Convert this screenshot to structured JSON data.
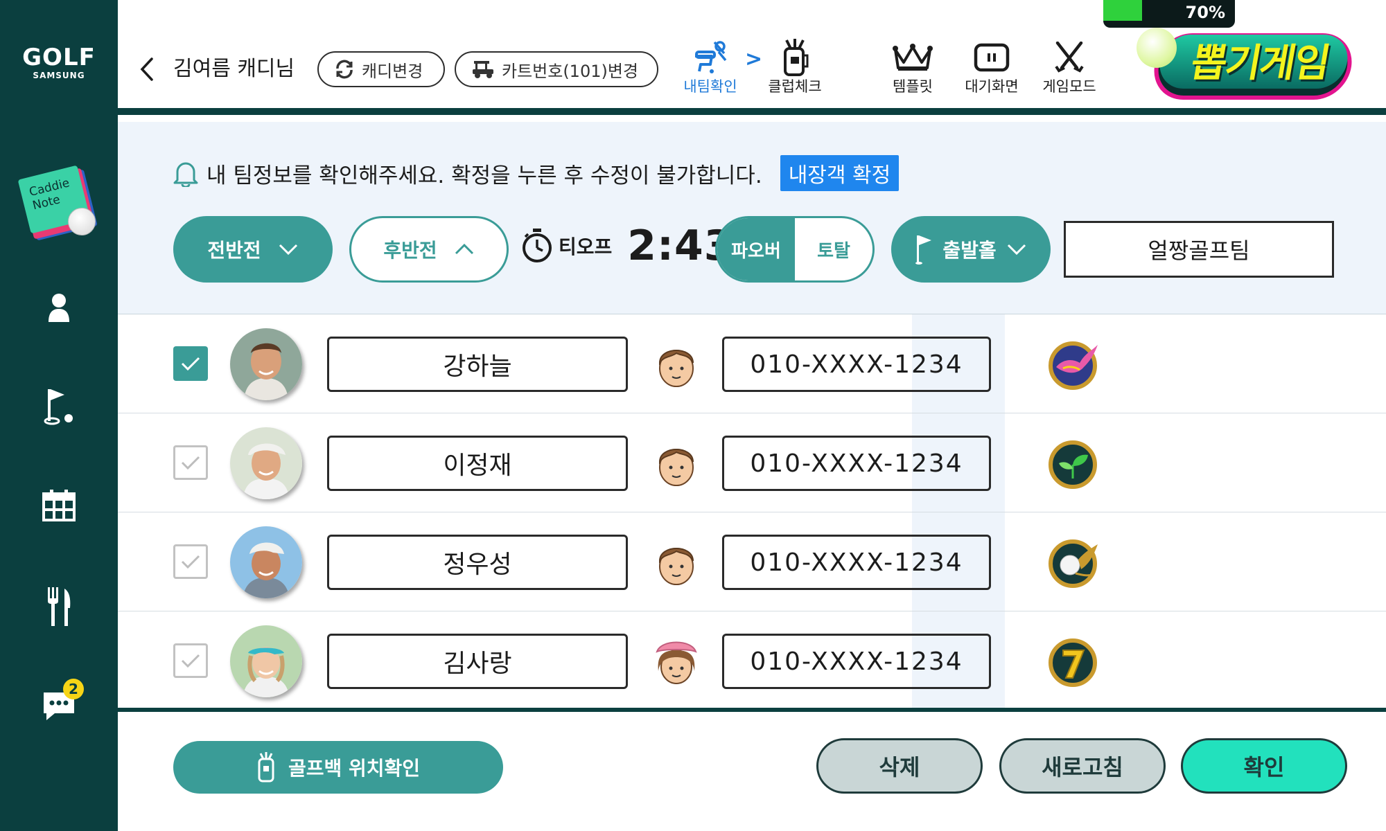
{
  "sidebar": {
    "logo_main": "GOLF",
    "logo_sub": "SAMSUNG",
    "caddie_note": "Caddie\nNote",
    "icons": [
      "person-icon",
      "flag-hole-icon",
      "calendar-icon",
      "fork-knife-icon",
      "chat-icon"
    ],
    "chat_badge": "2"
  },
  "header": {
    "caddie_name": "김여름 캐디님",
    "change_caddie": "캐디변경",
    "change_cart": "카트번호(101)변경",
    "nav": {
      "my_team": "내팀확인",
      "club_check": "클럽체크",
      "template": "템플릿",
      "standby": "대기화면",
      "game_mode": "게임모드"
    },
    "battery": "70%",
    "battery_level": 0.7,
    "game_banner": "뽑기게임"
  },
  "info": {
    "notice": "내 팀정보를 확인해주세요. 확정을 누른 후 수정이 불가합니다.",
    "confirm_tag": "내장객 확정",
    "first_half": "전반전",
    "second_half": "후반전",
    "teeoff_label": "티오프",
    "teeoff_time": "2:43",
    "score_par": "파오버",
    "score_total": "토탈",
    "start_hole": "출발홀",
    "team_name": "얼짱골프팀"
  },
  "players": [
    {
      "name": "강하늘",
      "phone": "010-XXXX-1234",
      "checked": true,
      "gender": "male",
      "grade": "phoenix"
    },
    {
      "name": "이정재",
      "phone": "010-XXXX-1234",
      "checked": false,
      "gender": "male",
      "grade": "sprout"
    },
    {
      "name": "정우성",
      "phone": "010-XXXX-1234",
      "checked": false,
      "gender": "male",
      "grade": "golfball-wing"
    },
    {
      "name": "김사랑",
      "phone": "010-XXXX-1234",
      "checked": false,
      "gender": "female",
      "grade": "seven"
    }
  ],
  "footer": {
    "bag_location": "골프백 위치확인",
    "delete": "삭제",
    "refresh": "새로고침",
    "confirm": "확인"
  },
  "colors": {
    "sidebar": "#0b3f3f",
    "teal": "#3a9c97",
    "accent_blue": "#1f86ee",
    "mint": "#22e1bd"
  }
}
